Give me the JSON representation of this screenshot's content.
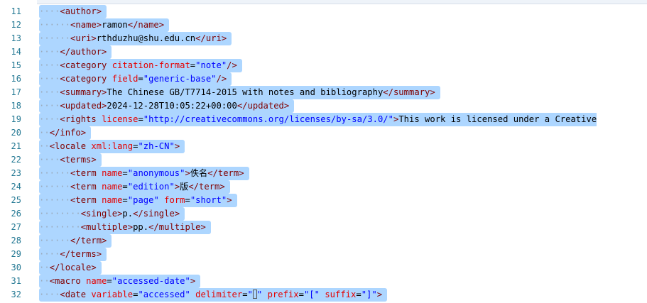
{
  "lines": [
    {
      "n": "11",
      "indent": "····",
      "tokens": [
        [
          "t",
          "<author>"
        ]
      ]
    },
    {
      "n": "12",
      "indent": "······",
      "tokens": [
        [
          "t",
          "<name>"
        ],
        [
          "x",
          "ramon"
        ],
        [
          "t",
          "</name>"
        ]
      ]
    },
    {
      "n": "13",
      "indent": "······",
      "tokens": [
        [
          "t",
          "<uri>"
        ],
        [
          "x",
          "rthduzhu@shu.edu.cn"
        ],
        [
          "t",
          "</uri>"
        ]
      ]
    },
    {
      "n": "14",
      "indent": "····",
      "tokens": [
        [
          "t",
          "</author>"
        ]
      ]
    },
    {
      "n": "15",
      "indent": "····",
      "tokens": [
        [
          "t",
          "<category "
        ],
        [
          "a",
          "citation-format"
        ],
        [
          "x",
          "="
        ],
        [
          "v",
          "\"note\""
        ],
        [
          "t",
          "/>"
        ]
      ]
    },
    {
      "n": "16",
      "indent": "····",
      "tokens": [
        [
          "t",
          "<category "
        ],
        [
          "a",
          "field"
        ],
        [
          "x",
          "="
        ],
        [
          "v",
          "\"generic-base\""
        ],
        [
          "t",
          "/>"
        ]
      ]
    },
    {
      "n": "17",
      "indent": "····",
      "tokens": [
        [
          "t",
          "<summary>"
        ],
        [
          "x",
          "The Chinese GB/T7714-2015 with notes and bibliography"
        ],
        [
          "t",
          "</summary>"
        ]
      ]
    },
    {
      "n": "18",
      "indent": "····",
      "tokens": [
        [
          "t",
          "<updated>"
        ],
        [
          "x",
          "2024-12-28T10:05:22+00:00"
        ],
        [
          "t",
          "</updated>"
        ]
      ]
    },
    {
      "n": "19",
      "indent": "····",
      "tokens": [
        [
          "t",
          "<rights "
        ],
        [
          "a",
          "license"
        ],
        [
          "x",
          "="
        ],
        [
          "v",
          "\"http://creativecommons.org/licenses/by-sa/3.0/\""
        ],
        [
          "t",
          ">"
        ],
        [
          "x",
          "This work is licensed under a Creative"
        ]
      ]
    },
    {
      "n": "20",
      "indent": "··",
      "tokens": [
        [
          "t",
          "</info>"
        ]
      ]
    },
    {
      "n": "21",
      "indent": "··",
      "tokens": [
        [
          "t",
          "<locale "
        ],
        [
          "a",
          "xml:lang"
        ],
        [
          "x",
          "="
        ],
        [
          "v",
          "\"zh-CN\""
        ],
        [
          "t",
          ">"
        ]
      ]
    },
    {
      "n": "22",
      "indent": "····",
      "tokens": [
        [
          "t",
          "<terms>"
        ]
      ]
    },
    {
      "n": "23",
      "indent": "······",
      "tokens": [
        [
          "t",
          "<term "
        ],
        [
          "a",
          "name"
        ],
        [
          "x",
          "="
        ],
        [
          "v",
          "\"anonymous\""
        ],
        [
          "t",
          ">"
        ],
        [
          "x",
          "佚名"
        ],
        [
          "t",
          "</term>"
        ]
      ]
    },
    {
      "n": "24",
      "indent": "······",
      "tokens": [
        [
          "t",
          "<term "
        ],
        [
          "a",
          "name"
        ],
        [
          "x",
          "="
        ],
        [
          "v",
          "\"edition\""
        ],
        [
          "t",
          ">"
        ],
        [
          "x",
          "版"
        ],
        [
          "t",
          "</term>"
        ]
      ]
    },
    {
      "n": "25",
      "indent": "······",
      "tokens": [
        [
          "t",
          "<term "
        ],
        [
          "a",
          "name"
        ],
        [
          "x",
          "="
        ],
        [
          "v",
          "\"page\""
        ],
        [
          "t",
          " "
        ],
        [
          "a",
          "form"
        ],
        [
          "x",
          "="
        ],
        [
          "v",
          "\"short\""
        ],
        [
          "t",
          ">"
        ]
      ]
    },
    {
      "n": "26",
      "indent": "········",
      "tokens": [
        [
          "t",
          "<single>"
        ],
        [
          "x",
          "p."
        ],
        [
          "t",
          "</single>"
        ]
      ]
    },
    {
      "n": "27",
      "indent": "········",
      "tokens": [
        [
          "t",
          "<multiple>"
        ],
        [
          "x",
          "pp."
        ],
        [
          "t",
          "</multiple>"
        ]
      ]
    },
    {
      "n": "28",
      "indent": "······",
      "tokens": [
        [
          "t",
          "</term>"
        ]
      ]
    },
    {
      "n": "29",
      "indent": "····",
      "tokens": [
        [
          "t",
          "</terms>"
        ]
      ]
    },
    {
      "n": "30",
      "indent": "··",
      "tokens": [
        [
          "t",
          "</locale>"
        ]
      ]
    },
    {
      "n": "31",
      "indent": "··",
      "tokens": [
        [
          "t",
          "<macro "
        ],
        [
          "a",
          "name"
        ],
        [
          "x",
          "="
        ],
        [
          "v",
          "\"accessed-date\""
        ],
        [
          "t",
          ">"
        ]
      ]
    },
    {
      "n": "32",
      "indent": "····",
      "tokens": [
        [
          "t",
          "<date "
        ],
        [
          "a",
          "variable"
        ],
        [
          "x",
          "="
        ],
        [
          "v",
          "\"accessed\""
        ],
        [
          "t",
          " "
        ],
        [
          "a",
          "delimiter"
        ],
        [
          "x",
          "="
        ],
        [
          "v",
          "\""
        ],
        [
          "ph",
          ""
        ],
        [
          "v",
          "\""
        ],
        [
          "t",
          " "
        ],
        [
          "a",
          "prefix"
        ],
        [
          "x",
          "="
        ],
        [
          "v",
          "\"[\""
        ],
        [
          "t",
          " "
        ],
        [
          "a",
          "suffix"
        ],
        [
          "x",
          "="
        ],
        [
          "v",
          "\"]\""
        ],
        [
          "t",
          ">"
        ]
      ]
    }
  ]
}
